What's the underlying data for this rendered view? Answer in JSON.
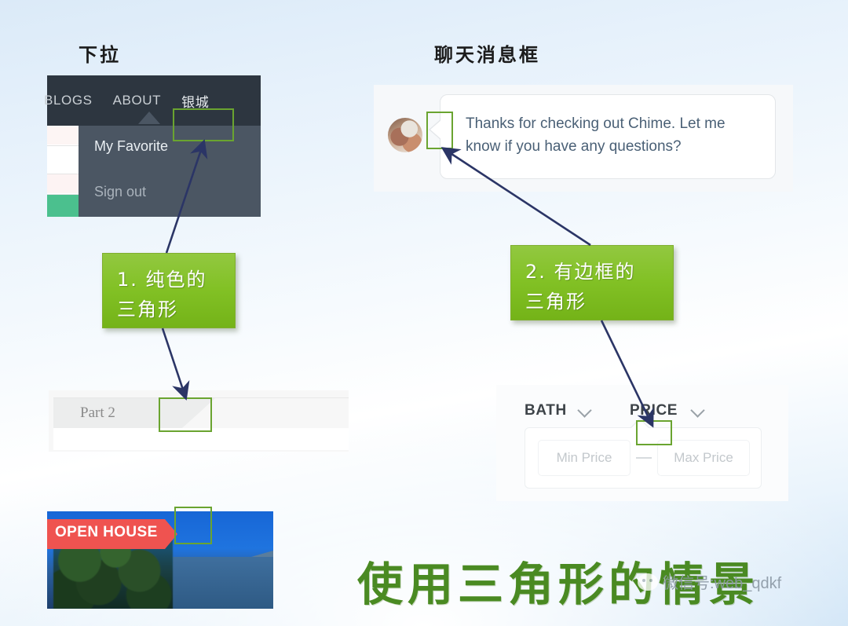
{
  "captions": {
    "left": "下拉",
    "right": "聊天消息框"
  },
  "nav": {
    "links": [
      "BLOGS",
      "ABOUT",
      "银城"
    ],
    "dropdown_items": [
      "My Favorite",
      "Sign out"
    ],
    "caret_icon": "caret-up-solid-icon"
  },
  "chat": {
    "message": "Thanks for checking out Chime. Let me know if you have any questions?",
    "avatar_icon": "avatar-photo",
    "tail_icon": "bubble-tail-outlined-icon"
  },
  "callouts": [
    {
      "line1": "1. 纯色的",
      "line2": "三角形"
    },
    {
      "line1": "2. 有边框的",
      "line2": "三角形"
    }
  ],
  "part_tab": {
    "label": "Part 2"
  },
  "filters": {
    "bath_label": "BATH",
    "price_label": "PRICE",
    "bath_caret_icon": "chevron-down-icon",
    "price_caret_icon": "chevron-down-icon",
    "min_price_placeholder": "Min Price",
    "max_price_placeholder": "Max Price",
    "separator": "—",
    "panel_caret_icon": "caret-up-outlined-icon"
  },
  "photo": {
    "ribbon_text": "OPEN HOUSE",
    "ribbon_color": "#ef5350",
    "notch_icon": "ribbon-notch-triangle-icon"
  },
  "footer": {
    "title": "使用三角形的情景",
    "watermark": "微信号:web_qdkf",
    "wechat_icon": "wechat-logo-icon"
  },
  "colors": {
    "highlight": "#6aa430",
    "arrow": "#2b3566",
    "callout_green": "#82c125",
    "title_green": "#4a8a22",
    "nav_dark": "#2d3640",
    "dropdown_gray": "#4b5663"
  }
}
